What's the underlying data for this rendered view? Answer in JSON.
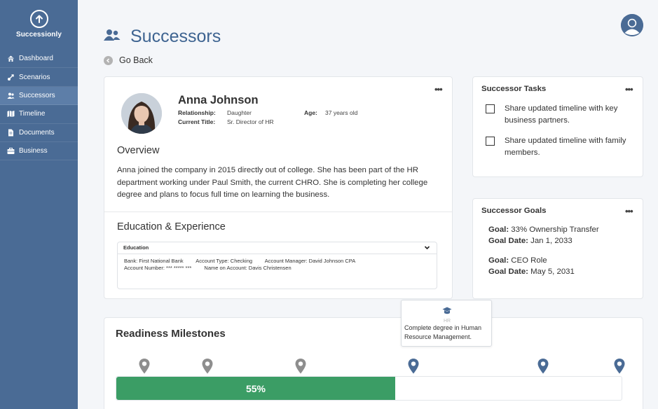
{
  "app": {
    "name": "Successionly"
  },
  "sidebar": {
    "items": [
      {
        "label": "Dashboard",
        "icon": "home-icon",
        "active": false
      },
      {
        "label": "Scenarios",
        "icon": "scenarios-icon",
        "active": false
      },
      {
        "label": "Successors",
        "icon": "users-icon",
        "active": true
      },
      {
        "label": "Timeline",
        "icon": "map-icon",
        "active": false
      },
      {
        "label": "Documents",
        "icon": "document-icon",
        "active": false
      },
      {
        "label": "Business",
        "icon": "briefcase-icon",
        "active": false
      }
    ]
  },
  "header": {
    "title": "Successors",
    "title_icon": "users-icon",
    "go_back": "Go Back"
  },
  "profile": {
    "name": "Anna Johnson",
    "relationship_label": "Relationship:",
    "relationship": "Daughter",
    "title_label": "Current Title:",
    "title": "Sr. Director of HR",
    "age_label": "Age:",
    "age": "37 years old",
    "overview_heading": "Overview",
    "overview_text": "Anna joined the company in 2015 directly out of college. She has been part of the HR department working under Paul Smith, the current CHRO. She is completing her college degree and plans to focus full time on learning the business.",
    "education_heading": "Education & Experience",
    "education": {
      "header": "Education",
      "bank": "Bank: First National Bank",
      "account_type": "Account Type: Checking",
      "account_manager": "Account Manager: David Johnson CPA",
      "account_number": "Account Number: *** ***** ***",
      "account_name": "Name on Account: Davis Christensen"
    }
  },
  "tasks": {
    "title": "Successor Tasks",
    "items": [
      {
        "text": "Share updated timeline with key business partners.",
        "checked": false
      },
      {
        "text": "Share updated timeline with family members.",
        "checked": false
      }
    ]
  },
  "goals": {
    "title": "Successor Goals",
    "goal_label": "Goal:",
    "date_label": "Goal Date:",
    "items": [
      {
        "goal": "33% Ownership Transfer",
        "date": "Jan 1, 2033"
      },
      {
        "goal": "CEO Role",
        "date": "May 5, 2031"
      }
    ]
  },
  "milestones": {
    "title": "Readiness Milestones",
    "progress_percent": 55,
    "progress_label": "55%",
    "tooltip": {
      "icon": "graduation-cap-icon",
      "small_text": "HR",
      "text": "Complete degree in Human Resource Management."
    },
    "pins": [
      {
        "status": "completed"
      },
      {
        "status": "completed"
      },
      {
        "status": "completed"
      },
      {
        "status": "current"
      },
      {
        "status": "upcoming"
      },
      {
        "status": "upcoming"
      }
    ]
  },
  "colors": {
    "sidebar": "#4a6b95",
    "sidebar_active": "#5d7ea8",
    "accent": "#3e6491",
    "progress": "#3b9d65",
    "pin_done": "#8e8e8e",
    "pin_active": "#4a6b95"
  }
}
